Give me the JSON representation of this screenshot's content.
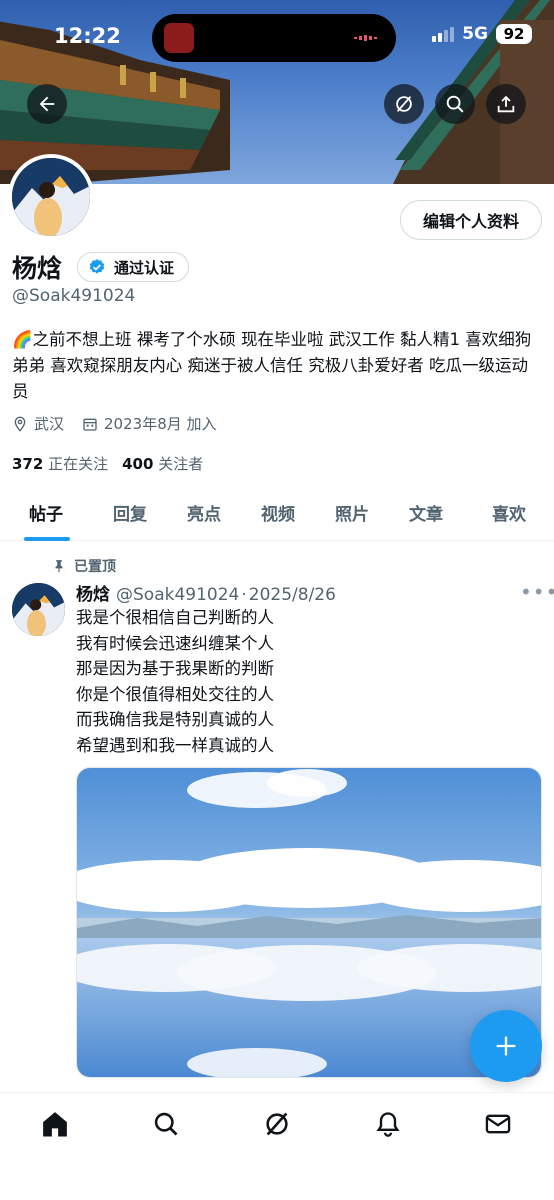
{
  "status_bar": {
    "time": "12:22",
    "network": "5G",
    "battery": "92"
  },
  "header": {
    "back_icon": "arrow-left-icon",
    "grok_icon": "grok-icon",
    "search_icon": "search-icon",
    "share_icon": "share-icon"
  },
  "profile": {
    "name": "杨焓",
    "verified_label": "通过认证",
    "handle": "@Soak491024",
    "edit_button": "编辑个人资料",
    "bio": "🌈之前不想上班 裸考了个水硕 现在毕业啦 武汉工作 黏人精1 喜欢细狗弟弟 喜欢窥探朋友内心 痴迷于被人信任 究极八卦爱好者 吃瓜一级运动员",
    "location": "武汉",
    "joined": "2023年8月 加入",
    "following_count": "372",
    "following_label": "正在关注",
    "followers_count": "400",
    "followers_label": "关注者"
  },
  "tabs": [
    {
      "label": "帖子",
      "active": true
    },
    {
      "label": "回复",
      "active": false
    },
    {
      "label": "亮点",
      "active": false
    },
    {
      "label": "视频",
      "active": false
    },
    {
      "label": "照片",
      "active": false
    },
    {
      "label": "文章",
      "active": false
    },
    {
      "label": "喜欢",
      "active": false
    }
  ],
  "pinned_post": {
    "pinned_label": "已置顶",
    "author_name": "杨焓",
    "author_handle": "@Soak491024",
    "date": "2025/8/26",
    "lines": [
      "我是个很相信自己判断的人",
      "我有时候会迅速纠缠某个人",
      "那是因为基于我果断的判断",
      "你是个很值得相处交往的人",
      "而我确信我是特别真诚的人",
      "希望遇到和我一样真诚的人"
    ]
  },
  "compose_icon": "plus-icon",
  "bottom_nav": [
    "home-icon",
    "search-icon",
    "grok-icon",
    "bell-icon",
    "mail-icon"
  ],
  "colors": {
    "accent": "#1d9bf0",
    "secondary_text": "#536471",
    "verified": "#1d9bf0"
  }
}
